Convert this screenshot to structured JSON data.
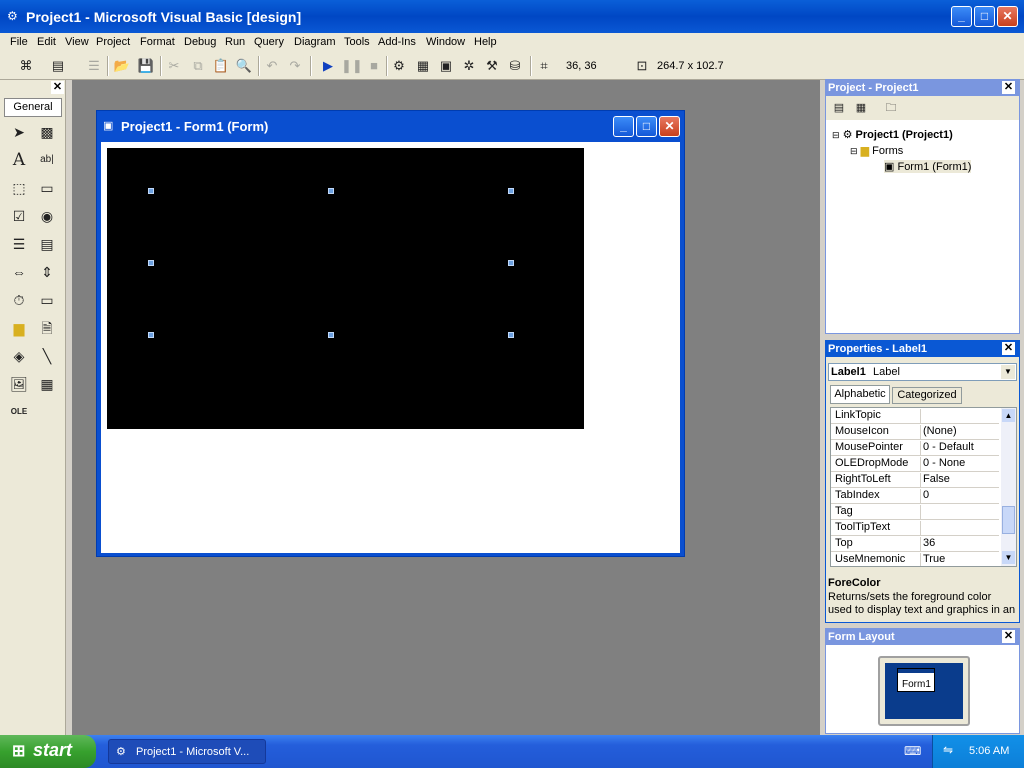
{
  "window": {
    "title": "Project1 - Microsoft Visual Basic [design]",
    "app_icon": "vb-ide-icon",
    "controls": {
      "minimize": "_",
      "maximize": "□",
      "close": "✕"
    }
  },
  "menu": [
    "File",
    "Edit",
    "View",
    "Project",
    "Format",
    "Debug",
    "Run",
    "Query",
    "Diagram",
    "Tools",
    "Add-Ins",
    "Window",
    "Help"
  ],
  "toolbar": {
    "position_readout": "36, 36",
    "size_readout": "264.7 x 102.7"
  },
  "toolbox": {
    "tab_label": "General",
    "tools": [
      "pointer",
      "picturebox",
      "label",
      "textbox",
      "frame",
      "commandbutton",
      "checkbox",
      "optionbutton",
      "combobox",
      "listbox",
      "hscrollbar",
      "vscrollbar",
      "timer",
      "drivelistbox",
      "dirlistbox",
      "filelistbox",
      "shape",
      "line",
      "image",
      "data",
      "ole"
    ]
  },
  "form_window": {
    "title": "Project1 - Form1 (Form)",
    "picture_bg": "#000000",
    "label1_color": "#c00000",
    "label1_text": ""
  },
  "project_panel": {
    "title": "Project - Project1",
    "tree": {
      "root": "Project1 (Project1)",
      "folder": "Forms",
      "item": "Form1 (Form1)"
    }
  },
  "properties_panel": {
    "title": "Properties - Label1",
    "object_name": "Label1",
    "object_type": "Label",
    "tabs": [
      "Alphabetic",
      "Categorized"
    ],
    "rows": [
      {
        "name": "LinkTopic",
        "value": ""
      },
      {
        "name": "MouseIcon",
        "value": "(None)"
      },
      {
        "name": "MousePointer",
        "value": "0 - Default"
      },
      {
        "name": "OLEDropMode",
        "value": "0 - None"
      },
      {
        "name": "RightToLeft",
        "value": "False"
      },
      {
        "name": "TabIndex",
        "value": "0"
      },
      {
        "name": "Tag",
        "value": ""
      },
      {
        "name": "ToolTipText",
        "value": ""
      },
      {
        "name": "Top",
        "value": "36"
      },
      {
        "name": "UseMnemonic",
        "value": "True"
      }
    ],
    "desc_title": "ForeColor",
    "desc_text": "Returns/sets the foreground color used to display text and graphics in an"
  },
  "form_layout_panel": {
    "title": "Form Layout",
    "form_label": "Form1"
  },
  "taskbar": {
    "start_label": "start",
    "task_label": "Project1 - Microsoft V...",
    "clock": "5:06 AM"
  }
}
